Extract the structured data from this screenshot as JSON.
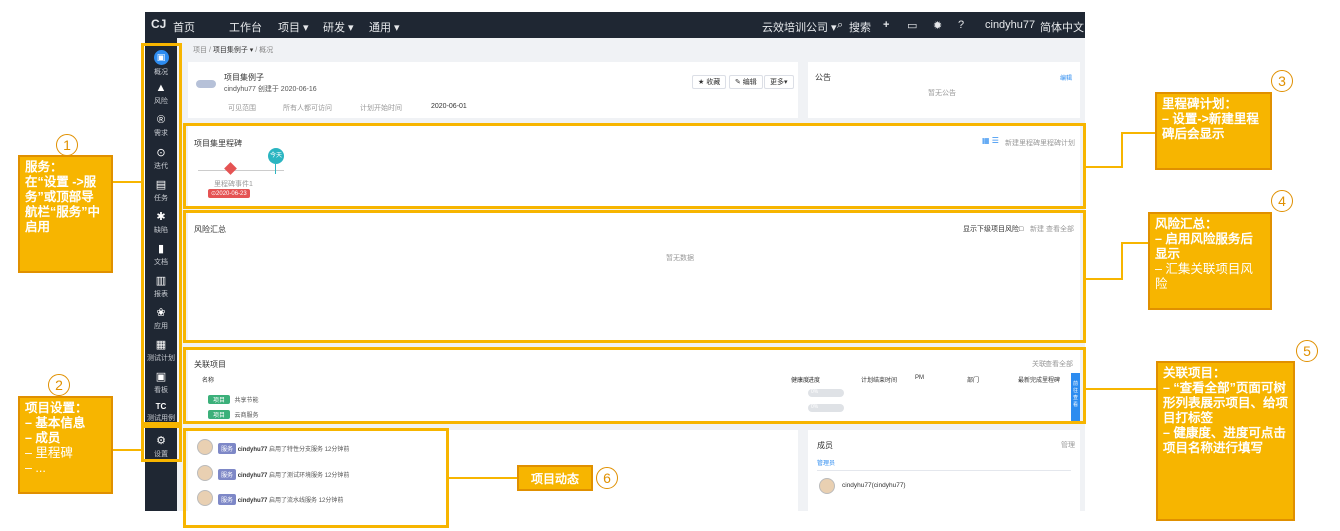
{
  "topnav": {
    "logo": "CJ",
    "items": [
      "首页",
      "工作台",
      "项目 ▾",
      "研发 ▾",
      "通用 ▾"
    ],
    "right": {
      "company": "云效培训公司 ▾",
      "search": "搜索",
      "user": "cindyhu77",
      "lang": "简体中文"
    }
  },
  "sidebar": {
    "items": [
      "概况",
      "风险",
      "需求",
      "迭代",
      "任务",
      "缺陷",
      "文档",
      "报表",
      "应用",
      "测试计划",
      "看板",
      "测试用例",
      "设置"
    ],
    "marks": [
      "▣",
      "▲",
      "®",
      "⊙",
      "▤",
      "✱",
      "▮",
      "▥",
      "❀",
      "▦",
      "▣",
      "TC",
      "⚙"
    ]
  },
  "breadcrumb": {
    "root": "项目",
    "current": "项目集例子 ▾",
    "sub": "概况"
  },
  "project": {
    "name": "项目集例子",
    "creator": "cindyhu77 创建于 2020-06-16",
    "visibility_label": "可见范围",
    "visibility_value": "所有人都可访问",
    "start_label": "计划开始时间",
    "start_value": "2020-06-01",
    "btn_fav": "★ 收藏",
    "btn_edit": "✎ 编辑",
    "btn_more": "更多▾"
  },
  "notice": {
    "title": "公告",
    "action": "编辑",
    "empty": "暂无公告"
  },
  "milestone": {
    "title": "项目集里程碑",
    "today": "今天",
    "item": "里程碑事件1",
    "date": "⊙2020-06-23",
    "new": "新建里程碑",
    "plan": "里程碑计划"
  },
  "risk": {
    "title": "风险汇总",
    "show_sub": "显示下级项目风险□",
    "new": "新建",
    "view_all": "查看全部",
    "empty": "暂无数据"
  },
  "related": {
    "title": "关联项目",
    "link": "关联",
    "view_all": "查看全部",
    "cols": [
      "名称",
      "健康度",
      "进度",
      "计划结束时间",
      "PM",
      "部门",
      "最新完成里程碑"
    ],
    "rows": [
      {
        "tag": "项目",
        "name": "共享节能",
        "progress": "0%"
      },
      {
        "tag": "项目",
        "name": "云商服务",
        "progress": "0%"
      }
    ],
    "side_btn": "前往查看"
  },
  "activity": {
    "items": [
      {
        "user": "cindyhu77",
        "badge": "服务",
        "text": "启用了特性分支服务 12分钟前"
      },
      {
        "user": "cindyhu77",
        "badge": "服务",
        "text": "启用了测试环境服务 12分钟前"
      },
      {
        "user": "cindyhu77",
        "badge": "服务",
        "text": "启用了流水线服务 12分钟前"
      }
    ]
  },
  "members": {
    "title": "成员",
    "manage": "管理",
    "admin": "管理员",
    "member": "cindyhu77(cindyhu77)"
  },
  "callouts": {
    "c1": {
      "num": "1",
      "title": "服务：",
      "body": "在“设置 ->服务”或顶部导航栏“服务”中启用"
    },
    "c2": {
      "num": "2",
      "title": "项目设置：",
      "lines": [
        "– 基本信息",
        "– 成员",
        "– 里程碑",
        "– ..."
      ]
    },
    "c3": {
      "num": "3",
      "title": "里程碑计划：",
      "body": "– 设置->新建里程碑后会显示"
    },
    "c4": {
      "num": "4",
      "title": "风险汇总：",
      "line1": "– 启用风险服务后显示",
      "line2": "– 汇集关联项目风险"
    },
    "c5": {
      "num": "5",
      "title": "关联项目：",
      "line1": "– “查看全部”页面可树形列表展示项目、给项目打标签",
      "line2": "– 健康度、进度可点击项目名称进行填写"
    },
    "c6": {
      "num": "6",
      "title": "项目动态"
    }
  },
  "colors": {
    "accent": "#f7b500",
    "nav": "#1f2733",
    "primary": "#2d8cf0",
    "danger": "#e55353"
  }
}
